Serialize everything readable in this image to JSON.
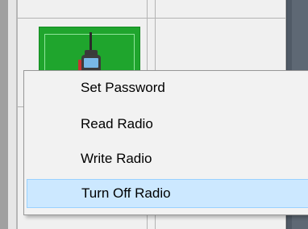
{
  "context_menu": {
    "items": [
      {
        "label": "Set Password",
        "highlighted": false
      },
      {
        "label": "Read Radio",
        "highlighted": false
      },
      {
        "label": "Write Radio",
        "highlighted": false
      },
      {
        "label": "Turn Off Radio",
        "highlighted": true
      }
    ]
  },
  "device_tile": {
    "icon": "radio-icon",
    "color": "#1fa52d"
  },
  "colors": {
    "highlight": "#cce8ff",
    "highlight_border": "#99d1ff",
    "panel_dark": "#505a66"
  }
}
